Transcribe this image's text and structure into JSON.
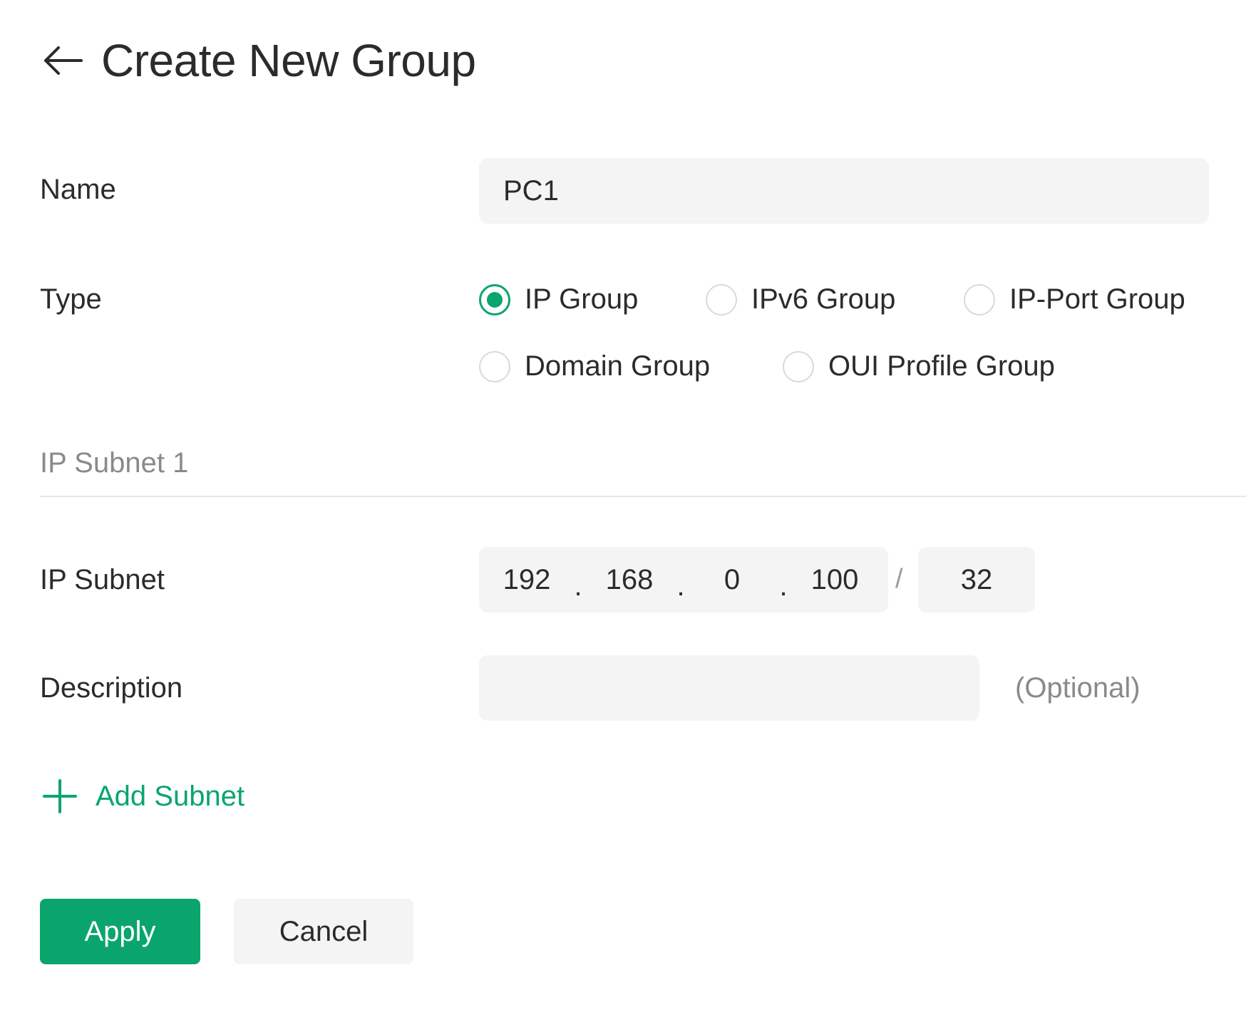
{
  "header": {
    "title": "Create New Group"
  },
  "form": {
    "name_label": "Name",
    "name_value": "PC1",
    "type_label": "Type",
    "type_options": [
      {
        "label": "IP Group",
        "checked": true
      },
      {
        "label": "IPv6 Group",
        "checked": false
      },
      {
        "label": "IP-Port Group",
        "checked": false
      },
      {
        "label": "Domain Group",
        "checked": false
      },
      {
        "label": "OUI Profile Group",
        "checked": false
      }
    ],
    "section_title": "IP Subnet 1",
    "ip_subnet_label": "IP Subnet",
    "ip_octets": [
      "192",
      "168",
      "0",
      "100"
    ],
    "ip_separator": ".",
    "mask_separator": "/",
    "mask_value": "32",
    "description_label": "Description",
    "description_value": "",
    "optional_text": "(Optional)",
    "add_subnet_label": "Add Subnet"
  },
  "actions": {
    "apply_label": "Apply",
    "cancel_label": "Cancel"
  },
  "colors": {
    "accent": "#0aa56d",
    "field_bg": "#f4f4f4",
    "muted_text": "#8a8a8a"
  }
}
